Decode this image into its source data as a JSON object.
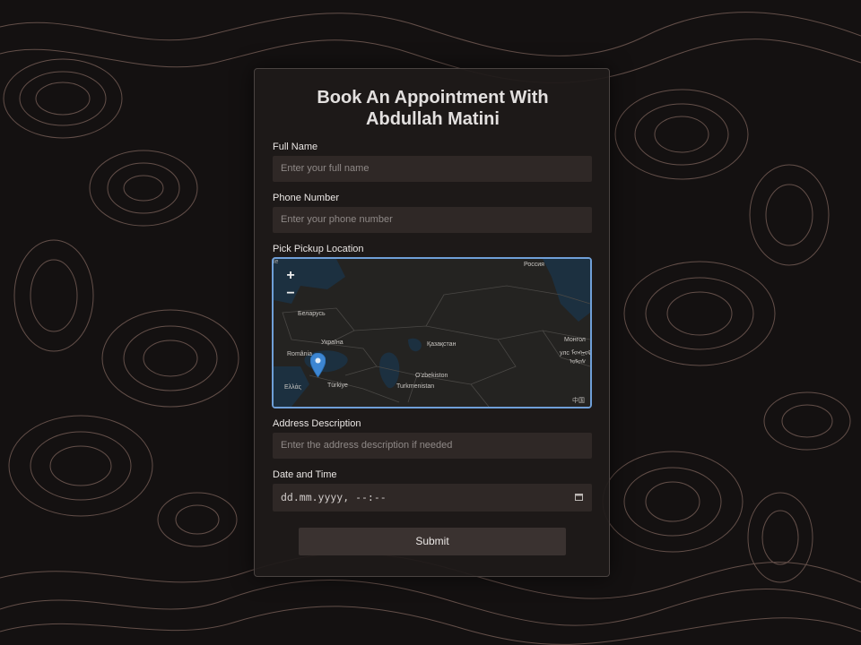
{
  "form": {
    "title": "Book An Appointment With\nAbdullah Matini",
    "full_name": {
      "label": "Full Name",
      "placeholder": "Enter your full name"
    },
    "phone": {
      "label": "Phone Number",
      "placeholder": "Enter your phone number"
    },
    "map_section": {
      "label": "Pick Pickup Location"
    },
    "address": {
      "label": "Address Description",
      "placeholder": "Enter the address description if needed"
    },
    "datetime": {
      "label": "Date and Time",
      "value": "dd.mm.yyyy, --:--"
    },
    "submit_label": "Submit"
  },
  "map": {
    "zoom_in": "+",
    "zoom_out": "−",
    "attribution_left": "le",
    "attribution_right": "中国",
    "labels": {
      "russia": "Россия",
      "belarus": "Беларусь",
      "ukraine": "Україна",
      "romania": "România",
      "kazakhstan": "Қазақстан",
      "mongolia_1": "Монгол",
      "mongolia_2": "улс ᠮᠣᠩᠭᠣᠯ",
      "mongolia_3": "ᠤᠯᠤᠰ",
      "uzbekistan": "O'zbekiston",
      "turkmenistan": "Turkmenistan",
      "turkiye": "Türkiye",
      "greece": "Ελλάς"
    },
    "marker_icon": "map-pin-icon",
    "marker_color": "#3d86d2"
  },
  "colors": {
    "background": "#141111",
    "contour": "#8a6e66",
    "card": "#1e1a19",
    "input": "#2f2826",
    "map_border": "#6f9fd8"
  }
}
